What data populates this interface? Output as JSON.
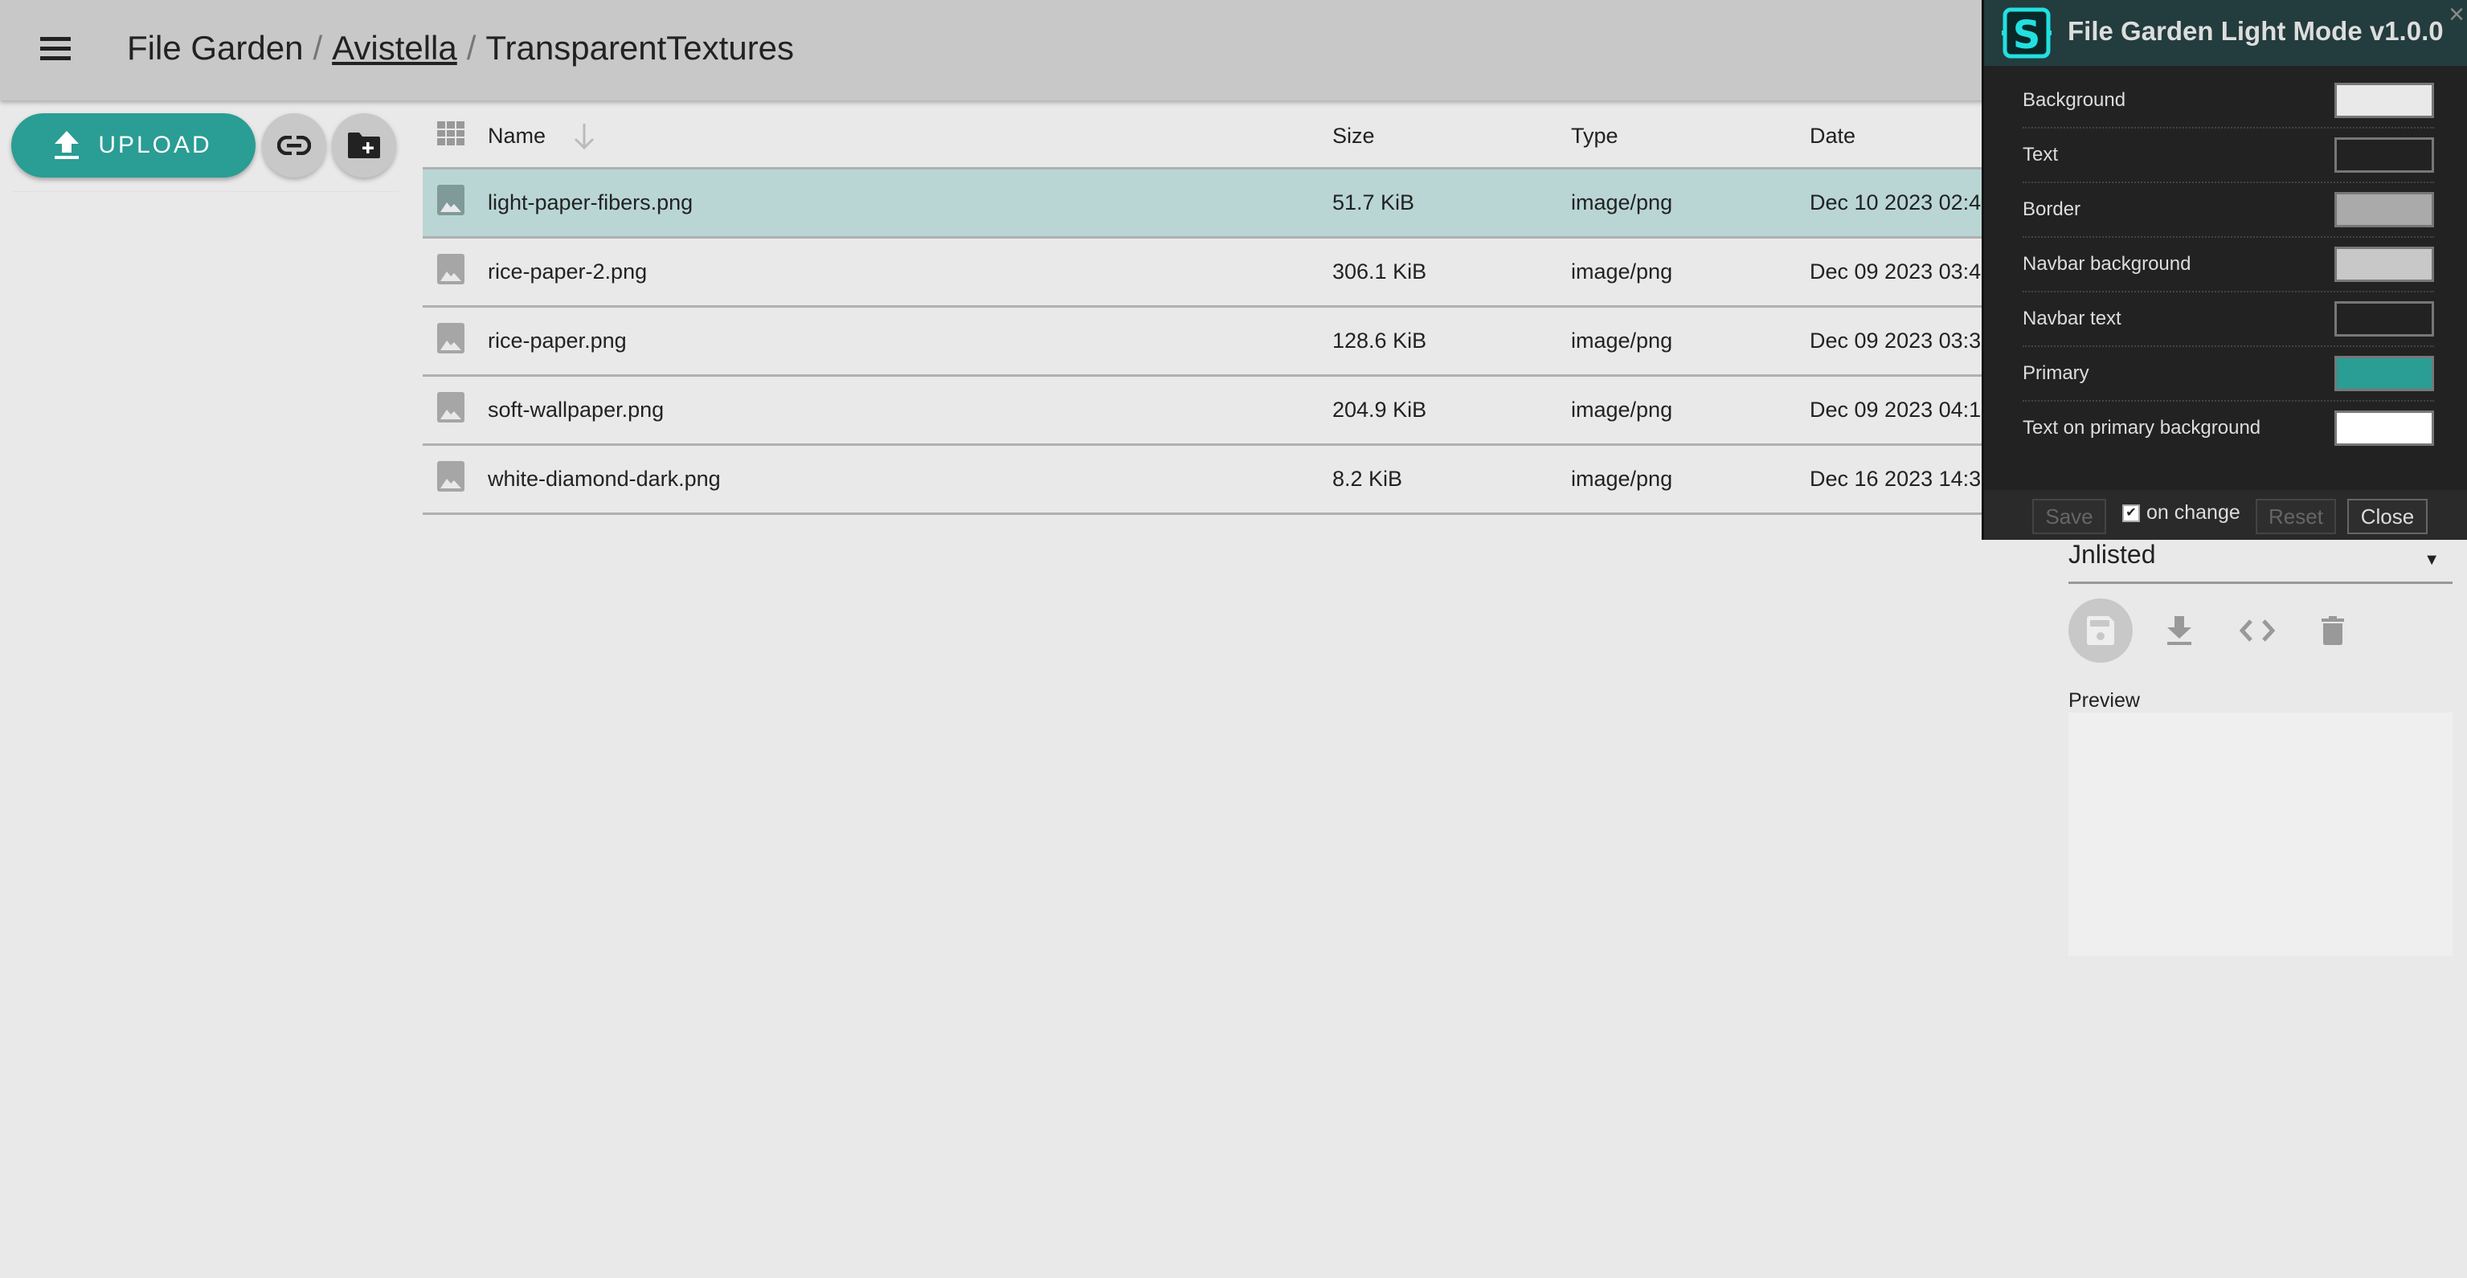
{
  "navbar": {
    "menu_icon": "hamburger-menu-icon",
    "breadcrumb": [
      {
        "label": "File Garden",
        "link": false
      },
      {
        "label": "Avistella",
        "link": true
      },
      {
        "label": "TransparentTextures",
        "link": false
      }
    ],
    "separator": "/"
  },
  "sidebar": {
    "upload_label": "UPLOAD",
    "upload_icon": "upload-icon",
    "link_icon": "link-icon",
    "new_folder_icon": "new-folder-icon"
  },
  "table": {
    "headers": {
      "name": "Name",
      "size": "Size",
      "type": "Type",
      "date": "Date"
    },
    "sort": "name-descending",
    "rows": [
      {
        "name": "light-paper-fibers.png",
        "size": "51.7 KiB",
        "type": "image/png",
        "date": "Dec 10 2023 02:4",
        "selected": true
      },
      {
        "name": "rice-paper-2.png",
        "size": "306.1 KiB",
        "type": "image/png",
        "date": "Dec 09 2023 03:4",
        "selected": false
      },
      {
        "name": "rice-paper.png",
        "size": "128.6 KiB",
        "type": "image/png",
        "date": "Dec 09 2023 03:3",
        "selected": false
      },
      {
        "name": "soft-wallpaper.png",
        "size": "204.9 KiB",
        "type": "image/png",
        "date": "Dec 09 2023 04:1",
        "selected": false
      },
      {
        "name": "white-diamond-dark.png",
        "size": "8.2 KiB",
        "type": "image/png",
        "date": "Dec 16 2023 14:3",
        "selected": false
      }
    ]
  },
  "panel": {
    "title": "File Garden Light Mode v1.0.0",
    "close_glyph": "×",
    "settings": [
      {
        "label": "Background",
        "color": "#e9e9e9"
      },
      {
        "label": "Text",
        "color": "#222222"
      },
      {
        "label": "Border",
        "color": "#aaaaaa"
      },
      {
        "label": "Navbar background",
        "color": "#c8c8c8"
      },
      {
        "label": "Navbar text",
        "color": "#222222"
      },
      {
        "label": "Primary",
        "color": "#2a9d94"
      },
      {
        "label": "Text on primary background",
        "color": "#ffffff"
      }
    ],
    "footer": {
      "save": "Save",
      "on_change": "on change",
      "on_change_checked": true,
      "reset": "Reset",
      "close": "Close"
    }
  },
  "details": {
    "visibility": "Jnlisted",
    "preview_label": "Preview"
  },
  "colors": {
    "primary": "#2a9d94",
    "selected_row": "#b9d6d5",
    "navbar": "#c8c8c8",
    "panel_header": "#233c3d"
  }
}
